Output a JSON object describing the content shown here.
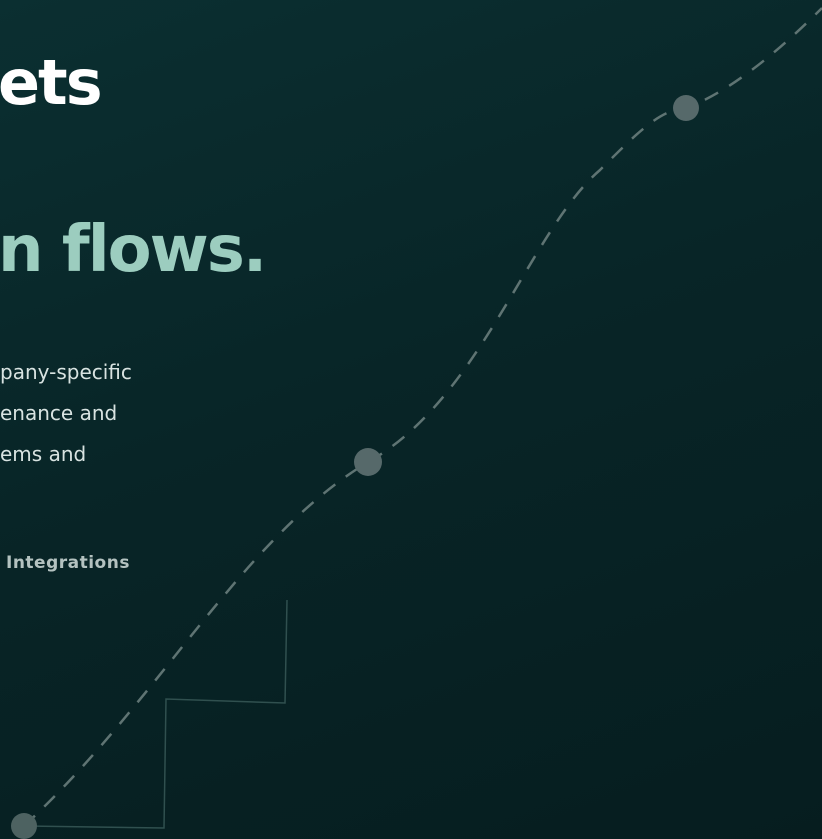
{
  "hero": {
    "title_line_1": "ets",
    "title_line_2": "n flows.",
    "body_lines": [
      "pany-specific",
      "enance and",
      "ems and"
    ],
    "tag_label": "Integrations"
  },
  "colors": {
    "background": "#082527",
    "accent": "#9ccdbf",
    "node": "#6a7f80"
  }
}
